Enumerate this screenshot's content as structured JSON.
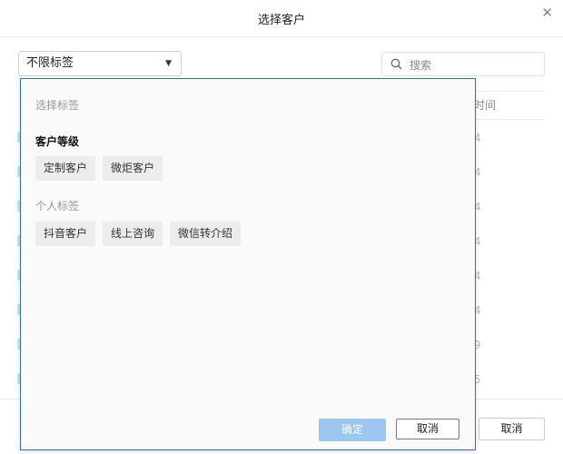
{
  "dialog": {
    "title": "选择客户",
    "close_icon": "close-icon"
  },
  "filter": {
    "tag_select_value": "不限标签",
    "search_placeholder": "搜索"
  },
  "background_table": {
    "partial_header": "时间",
    "partial_cells": [
      "4",
      "4",
      "4",
      "4",
      "4",
      "4",
      "9",
      "5"
    ]
  },
  "footer": {
    "cancel_label": "取消"
  },
  "tag_panel": {
    "heading": "选择标签",
    "groups": [
      {
        "title": "客户等级",
        "tags": [
          "定制客户",
          "微炬客户"
        ]
      },
      {
        "title": "个人标签",
        "tags": [
          "抖音客户",
          "线上咨询",
          "微信转介绍"
        ]
      }
    ],
    "ok_label": "确定",
    "cancel_label": "取消"
  },
  "colors": {
    "panel_border": "#2f6fba",
    "ok_button_disabled": "#9cc6f0",
    "chip_bg": "#ececec"
  }
}
